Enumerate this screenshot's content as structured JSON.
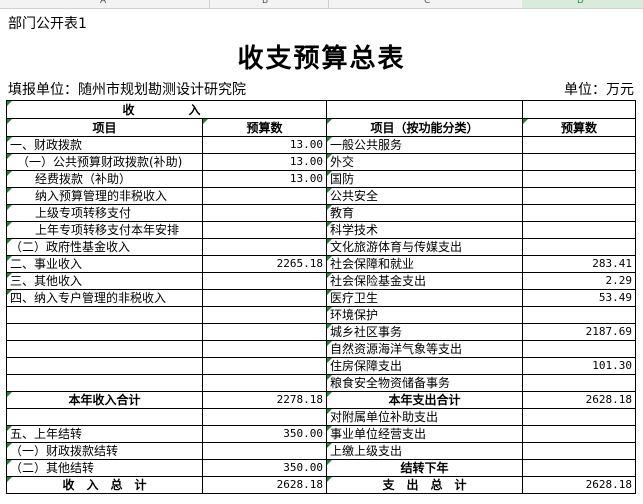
{
  "column_headers": [
    "A",
    "B",
    "C",
    "D"
  ],
  "doc_label": "部门公开表1",
  "title": "收支预算总表",
  "unit_left": "填报单位：随州市规划勘测设计研究院",
  "unit_right": "单位：万元",
  "section_income": "收　　入",
  "hdr": {
    "item": "项目",
    "budget": "预算数",
    "item_func": "项目（按功能分类）",
    "budget2": "预算数"
  },
  "rows": [
    {
      "l": "一、财政拨款",
      "lv": "13.00",
      "r": "一般公共服务",
      "rv": ""
    },
    {
      "l": "（一）公共预算财政拨款(补助)",
      "lv": "13.00",
      "r": "外交",
      "rv": ""
    },
    {
      "l": "经费拨款（补助）",
      "lv": "13.00",
      "r": "国防",
      "rv": ""
    },
    {
      "l": "纳入预算管理的非税收入",
      "lv": "",
      "r": "公共安全",
      "rv": ""
    },
    {
      "l": "上级专项转移支付",
      "lv": "",
      "r": "教育",
      "rv": ""
    },
    {
      "l": "上年专项转移支付本年安排",
      "lv": "",
      "r": "科学技术",
      "rv": ""
    },
    {
      "l": "（二）政府性基金收入",
      "lv": "",
      "r": "文化旅游体育与传媒支出",
      "rv": ""
    },
    {
      "l": "二、事业收入",
      "lv": "2265.18",
      "r": "社会保障和就业",
      "rv": "283.41"
    },
    {
      "l": "三、其他收入",
      "lv": "",
      "r": "社会保险基金支出",
      "rv": "2.29"
    },
    {
      "l": "四、纳入专户管理的非税收入",
      "lv": "",
      "r": "医疗卫生",
      "rv": "53.49"
    },
    {
      "l": "",
      "lv": "",
      "r": "环境保护",
      "rv": ""
    },
    {
      "l": "",
      "lv": "",
      "r": "城乡社区事务",
      "rv": "2187.69"
    },
    {
      "l": "",
      "lv": "",
      "r": "自然资源海洋气象等支出",
      "rv": ""
    },
    {
      "l": "",
      "lv": "",
      "r": "住房保障支出",
      "rv": "101.30"
    },
    {
      "l": "",
      "lv": "",
      "r": "粮食安全物资储备事务",
      "rv": ""
    },
    {
      "l": "本年收入合计",
      "lv": "2278.18",
      "r": "本年支出合计",
      "rv": "2628.18"
    },
    {
      "l": "",
      "lv": "",
      "r": "对附属单位补助支出",
      "rv": ""
    },
    {
      "l": "五、上年结转",
      "lv": "350.00",
      "r": "事业单位经营支出",
      "rv": ""
    },
    {
      "l": "（一）财政拨款结转",
      "lv": "",
      "r": "上缴上级支出",
      "rv": ""
    },
    {
      "l": "（二）其他结转",
      "lv": "350.00",
      "r": "结转下年",
      "rv": ""
    },
    {
      "l": "收　入　总　计",
      "lv": "2628.18",
      "r": "支　出　总　计",
      "rv": "2628.18"
    }
  ]
}
